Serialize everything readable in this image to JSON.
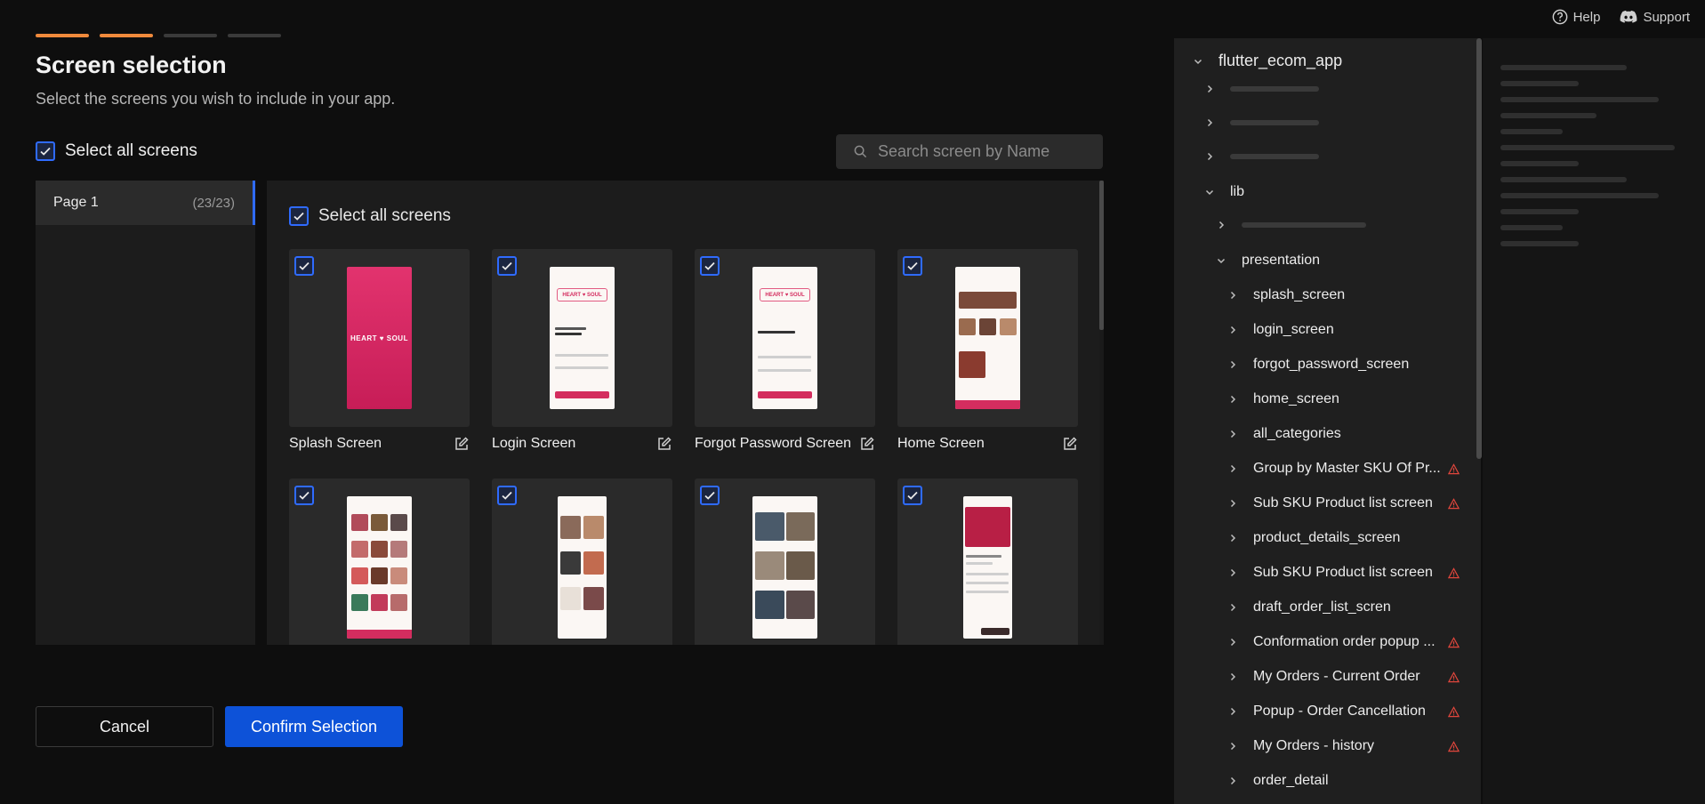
{
  "topnav": {
    "help": "Help",
    "support": "Support"
  },
  "stepper": {
    "total": 4,
    "completed": 2
  },
  "header": {
    "title": "Screen selection",
    "subtitle": "Select the screens you wish to include in your app."
  },
  "select_all_label": "Select all screens",
  "search": {
    "placeholder": "Search screen by Name"
  },
  "pages": [
    {
      "name": "Page 1",
      "count": "(23/23)"
    }
  ],
  "grid": {
    "select_all_label": "Select all screens",
    "cards": [
      {
        "label": "Splash Screen"
      },
      {
        "label": "Login Screen"
      },
      {
        "label": "Forgot Password Screen"
      },
      {
        "label": "Home Screen"
      },
      {
        "label": ""
      },
      {
        "label": ""
      },
      {
        "label": ""
      },
      {
        "label": ""
      }
    ]
  },
  "footer": {
    "cancel": "Cancel",
    "confirm": "Confirm Selection"
  },
  "tree": {
    "root": "flutter_ecom_app",
    "lib": "lib",
    "presentation": "presentation",
    "items": [
      {
        "label": "splash_screen",
        "warning": false
      },
      {
        "label": "login_screen",
        "warning": false
      },
      {
        "label": "forgot_password_screen",
        "warning": false
      },
      {
        "label": "home_screen",
        "warning": false
      },
      {
        "label": "all_categories",
        "warning": false
      },
      {
        "label": "Group by Master SKU Of Pr...",
        "warning": true
      },
      {
        "label": "Sub SKU Product list screen",
        "warning": true
      },
      {
        "label": "product_details_screen",
        "warning": false
      },
      {
        "label": "Sub SKU Product list screen",
        "warning": true
      },
      {
        "label": "draft_order_list_scren",
        "warning": false
      },
      {
        "label": "Conformation order popup ...",
        "warning": true
      },
      {
        "label": "My Orders - Current Order",
        "warning": true
      },
      {
        "label": "Popup - Order Cancellation",
        "warning": true
      },
      {
        "label": "My Orders - history",
        "warning": true
      },
      {
        "label": "order_detail",
        "warning": false
      }
    ]
  },
  "colors": {
    "accent": "#2f6bff",
    "step_done": "#f08a3c",
    "brand_pink": "#d42d5f",
    "warning": "#e0463c"
  }
}
